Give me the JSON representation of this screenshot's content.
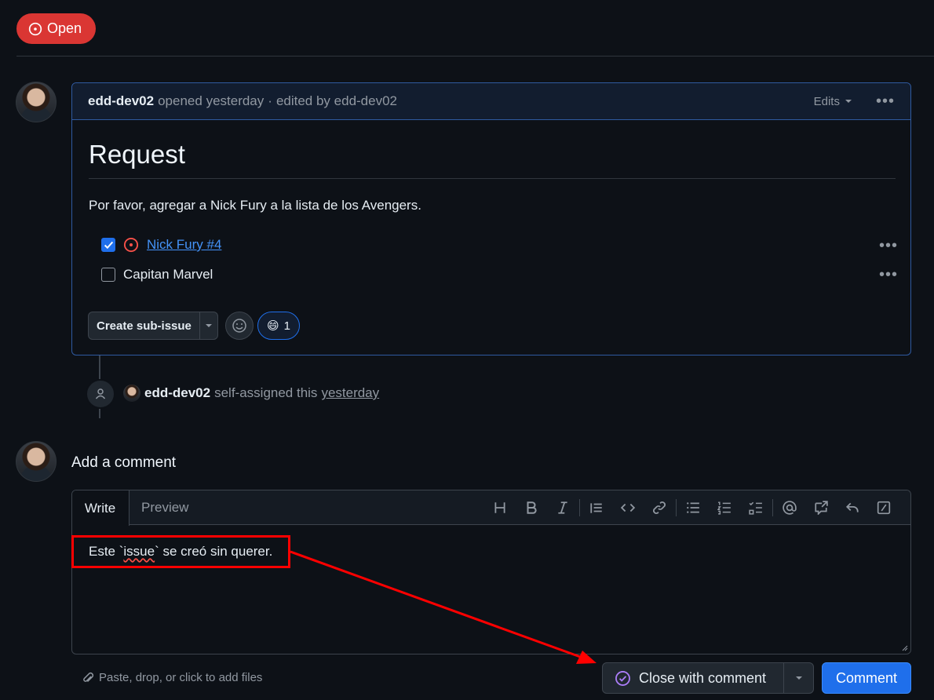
{
  "issue": {
    "state_label": "Open",
    "author": "edd-dev02",
    "opened_text": "opened",
    "opened_when": "yesterday",
    "separator": "·",
    "edited_text": "edited by edd-dev02",
    "edits_label": "Edits",
    "body": {
      "heading": "Request",
      "paragraph": "Por favor, agregar a Nick Fury a la lista de los Avengers.",
      "tasks": [
        {
          "label": "Nick Fury #4",
          "checked": true,
          "linked_issue": true
        },
        {
          "label": "Capitan Marvel",
          "checked": false,
          "linked_issue": false
        }
      ]
    },
    "create_subissue_label": "Create sub-issue",
    "reaction": {
      "emoji": "😄",
      "count": "1"
    }
  },
  "timeline": {
    "event_author": "edd-dev02",
    "event_text": "self-assigned this",
    "event_when": "yesterday"
  },
  "comment": {
    "title": "Add a comment",
    "tab_write": "Write",
    "tab_preview": "Preview",
    "text_before": "Este `",
    "text_squiggle": "issue",
    "text_after": "` se creó sin querer.",
    "attach_hint": "Paste, drop, or click to add files",
    "close_label": "Close with comment",
    "submit_label": "Comment"
  },
  "colors": {
    "open_red": "#da3633",
    "accent_blue": "#1f6feb",
    "annotation_red": "#ff0000",
    "close_icon_purple": "#ab7df8"
  },
  "icons": {
    "state": "issue-opened-icon",
    "toolbar": [
      "heading-icon",
      "bold-icon",
      "italic-icon",
      "quote-icon",
      "code-icon",
      "link-icon",
      "bulleted-list-icon",
      "numbered-list-icon",
      "task-list-icon",
      "mention-icon",
      "cross-reference-icon",
      "saved-replies-icon",
      "slash-commands-icon"
    ]
  }
}
